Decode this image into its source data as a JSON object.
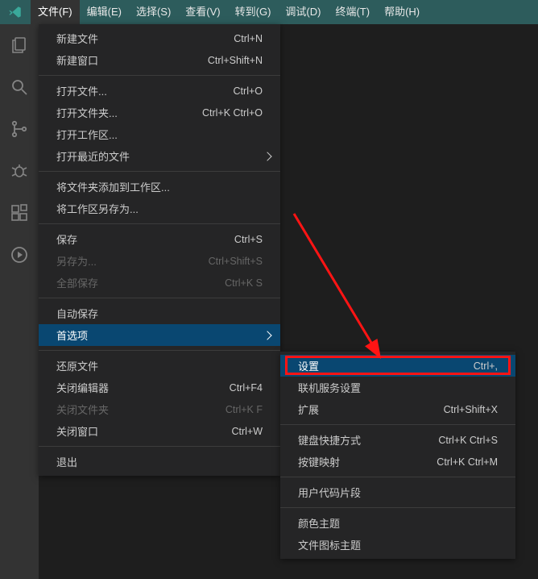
{
  "menubar": {
    "items": [
      {
        "label": "文件(F)"
      },
      {
        "label": "编辑(E)"
      },
      {
        "label": "选择(S)"
      },
      {
        "label": "查看(V)"
      },
      {
        "label": "转到(G)"
      },
      {
        "label": "调试(D)"
      },
      {
        "label": "终端(T)"
      },
      {
        "label": "帮助(H)"
      }
    ]
  },
  "file_menu": {
    "groups": [
      [
        {
          "label": "新建文件",
          "shortcut": "Ctrl+N"
        },
        {
          "label": "新建窗口",
          "shortcut": "Ctrl+Shift+N"
        }
      ],
      [
        {
          "label": "打开文件...",
          "shortcut": "Ctrl+O"
        },
        {
          "label": "打开文件夹...",
          "shortcut": "Ctrl+K Ctrl+O"
        },
        {
          "label": "打开工作区..."
        },
        {
          "label": "打开最近的文件",
          "submenu": true
        }
      ],
      [
        {
          "label": "将文件夹添加到工作区..."
        },
        {
          "label": "将工作区另存为..."
        }
      ],
      [
        {
          "label": "保存",
          "shortcut": "Ctrl+S"
        },
        {
          "label": "另存为...",
          "shortcut": "Ctrl+Shift+S",
          "disabled": true
        },
        {
          "label": "全部保存",
          "shortcut": "Ctrl+K S",
          "disabled": true
        }
      ],
      [
        {
          "label": "自动保存"
        },
        {
          "label": "首选项",
          "submenu": true,
          "hovered": true
        }
      ],
      [
        {
          "label": "还原文件"
        },
        {
          "label": "关闭编辑器",
          "shortcut": "Ctrl+F4"
        },
        {
          "label": "关闭文件夹",
          "shortcut": "Ctrl+K F",
          "disabled": true
        },
        {
          "label": "关闭窗口",
          "shortcut": "Ctrl+W"
        }
      ],
      [
        {
          "label": "退出"
        }
      ]
    ]
  },
  "preferences_submenu": {
    "groups": [
      [
        {
          "label": "设置",
          "shortcut": "Ctrl+,",
          "hovered": true
        },
        {
          "label": "联机服务设置"
        },
        {
          "label": "扩展",
          "shortcut": "Ctrl+Shift+X"
        }
      ],
      [
        {
          "label": "键盘快捷方式",
          "shortcut": "Ctrl+K Ctrl+S"
        },
        {
          "label": "按键映射",
          "shortcut": "Ctrl+K Ctrl+M"
        }
      ],
      [
        {
          "label": "用户代码片段"
        }
      ],
      [
        {
          "label": "颜色主题"
        },
        {
          "label": "文件图标主题"
        }
      ]
    ]
  }
}
